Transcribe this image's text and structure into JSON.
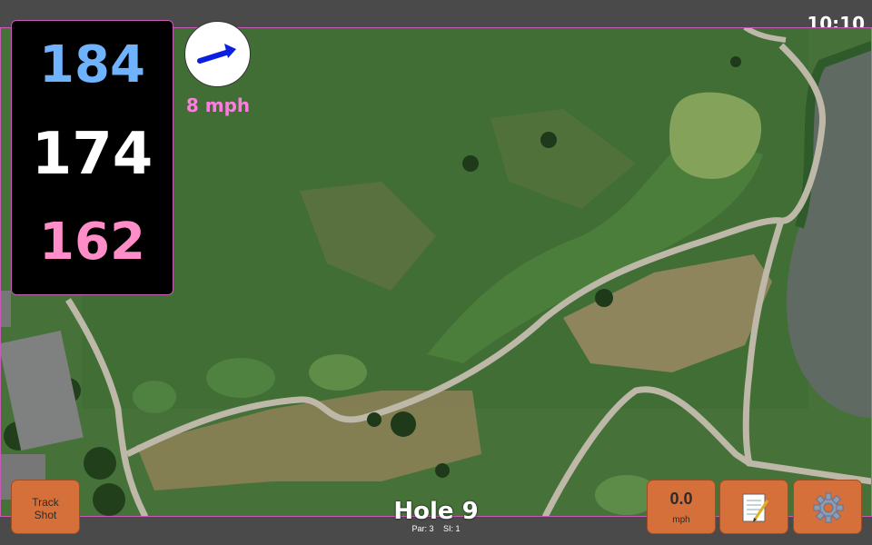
{
  "status": {
    "clock": "10:10"
  },
  "distances": {
    "back": "184",
    "middle": "174",
    "front": "162"
  },
  "wind": {
    "speed": "8 mph",
    "icon": "wind-arrow-icon"
  },
  "hole": {
    "title": "Hole 9",
    "par": "Par: 3",
    "si": "SI: 1"
  },
  "buttons": {
    "track_shot": "Track\nShot",
    "speed_value": "0.0",
    "speed_unit": "mph",
    "notes_icon": "notepad-icon",
    "settings_icon": "gear-icon"
  },
  "colors": {
    "back": "#6fb3ff",
    "middle": "#ffffff",
    "front": "#ff8ec8",
    "accent": "#d6703b",
    "panel_border": "#c85ab8"
  }
}
